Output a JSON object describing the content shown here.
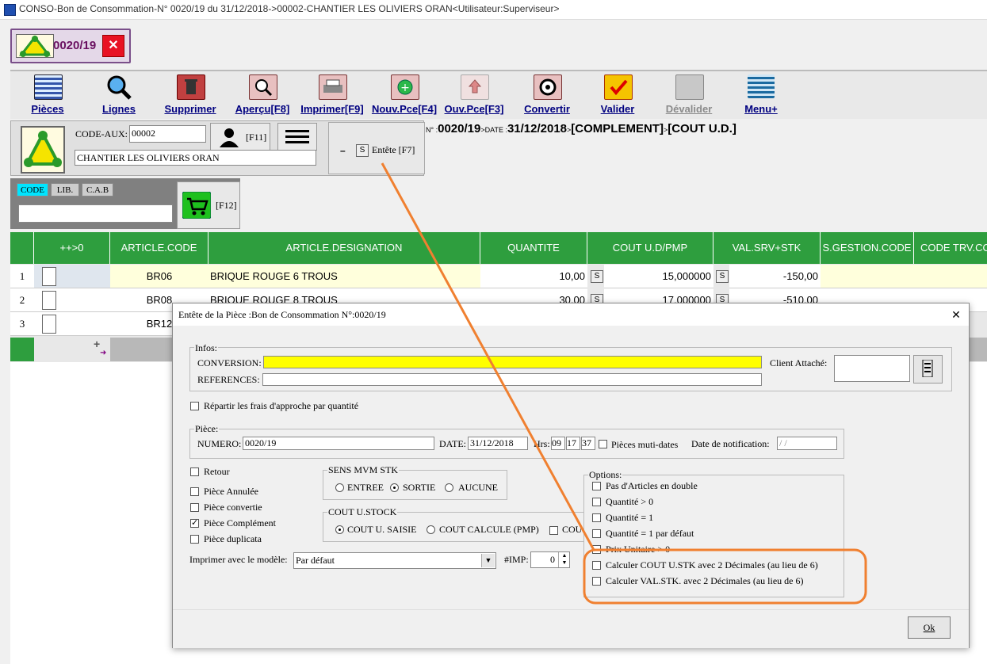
{
  "window": {
    "title": "CONSO-Bon de Consommation-N° 0020/19 du 31/12/2018->00002-CHANTIER LES OLIVIERS ORAN<Utilisateur:Superviseur>"
  },
  "doc_tab": {
    "number": "0020/19",
    "close": "✕"
  },
  "toolbar": [
    {
      "label": "Pièces"
    },
    {
      "label": "Lignes"
    },
    {
      "label": "Supprimer"
    },
    {
      "label": "Aperçu[F8]"
    },
    {
      "label": "Imprimer[F9]"
    },
    {
      "label": "Nouv.Pce[F4]"
    },
    {
      "label": "Ouv.Pce[F3]"
    },
    {
      "label": "Convertir"
    },
    {
      "label": "Valider"
    },
    {
      "label": "Dévalider"
    },
    {
      "label": "Menu+"
    }
  ],
  "header": {
    "code_aux_label": "CODE-AUX:",
    "code_aux_value": "00002",
    "f11": "[F11]",
    "client_name": "CHANTIER LES OLIVIERS ORAN",
    "entete_btn": "Entête [F7]",
    "s_label": "S",
    "minus": "–",
    "info_n": "N° :",
    "info_num": "0020/19",
    "info_date_lbl": "DATE :",
    "info_date": "31/12/2018",
    "info_tag1": "[COMPLEMENT]",
    "info_tag2": "[COUT U.D.]",
    "sep": ">"
  },
  "search": {
    "chips": [
      "CODE",
      "LIB.",
      "C.A.B"
    ],
    "f12": "[F12]"
  },
  "grid": {
    "headers": [
      "++>0",
      "ARTICLE.CODE",
      "ARTICLE.DESIGNATION",
      "QUANTITE",
      "COUT U.D/PMP",
      "VAL.SRV+STK",
      "S.GESTION.CODE",
      "CODE TRV.CO"
    ],
    "rows": [
      {
        "n": "1",
        "code": "BR06",
        "designation": "BRIQUE ROUGE 6 TROUS",
        "quantite": "10,00",
        "cout": "15,000000",
        "val": "-150,00"
      },
      {
        "n": "2",
        "code": "BR08",
        "designation": "BRIQUE ROUGE 8 TROUS",
        "quantite": "30,00",
        "cout": "17,000000",
        "val": "-510,00"
      },
      {
        "n": "3",
        "code": "BR12",
        "designation": "",
        "quantite": "",
        "cout": "",
        "val": ""
      }
    ],
    "add_symbol": "+",
    "arrow_symbol": "➜"
  },
  "dialog": {
    "title": "Entête de la Pièce :Bon de Consommation N°:0020/19",
    "close": "✕",
    "infos_legend": "Infos:",
    "conversion_label": "CONVERSION:",
    "references_label": "REFERENCES:",
    "client_attache_label": "Client Attaché:",
    "repartir_label": "Répartir les frais d'approche par quantité",
    "piece_legend": "Pièce:",
    "numero_label": "NUMERO:",
    "numero_value": "0020/19",
    "date_label": "DATE:",
    "date_value": "31/12/2018",
    "hrs_label": "Hrs:",
    "hrs_h": "09",
    "hrs_m": "17",
    "hrs_s": "37",
    "multi_dates_label": "Pièces muti-dates",
    "notif_label": "Date de notification:",
    "notif_value": " /  /",
    "left_checks": [
      {
        "label": "Retour",
        "checked": false
      },
      {
        "label": "Pièce Annulée",
        "checked": false
      },
      {
        "label": "Pièce convertie",
        "checked": false
      },
      {
        "label": "Pièce Complément",
        "checked": true
      },
      {
        "label": "Pièce duplicata",
        "checked": false
      }
    ],
    "sens_legend": "SENS MVM STK",
    "sens_options": [
      {
        "label": "ENTREE",
        "selected": false
      },
      {
        "label": "SORTIE",
        "selected": true
      },
      {
        "label": "AUCUNE",
        "selected": false
      }
    ],
    "cout_legend": "COUT U.STOCK",
    "cout_options": [
      {
        "label": "COUT U. SAISIE",
        "selected": true
      },
      {
        "label": "COUT CALCULE (PMP)",
        "selected": false
      },
      {
        "label": "COU",
        "selected": false
      }
    ],
    "modele_label": "Imprimer avec le modèle:",
    "modele_value": "Par défaut",
    "imp_label": "#IMP:",
    "imp_value": "0",
    "options_legend": "Options:",
    "options": [
      {
        "label": "Pas d'Articles en double",
        "checked": false
      },
      {
        "label": "Quantité > 0",
        "checked": false
      },
      {
        "label": "Quantité = 1",
        "checked": false
      },
      {
        "label": "Quantité = 1 par défaut",
        "checked": false
      },
      {
        "label": "Prix Unitaire > 0",
        "checked": false
      },
      {
        "label": "Calculer COUT U.STK avec 2 Décimales (au lieu de 6)",
        "checked": false
      },
      {
        "label": "Calculer VAL.STK. avec 2 Décimales (au lieu de 6)",
        "checked": false
      }
    ],
    "ok_label": "Ok"
  },
  "colors": {
    "grid_header": "#2e9e3e",
    "conversion_field": "#ffff00",
    "annotation": "#f08030",
    "title_text": "#6a1060"
  }
}
